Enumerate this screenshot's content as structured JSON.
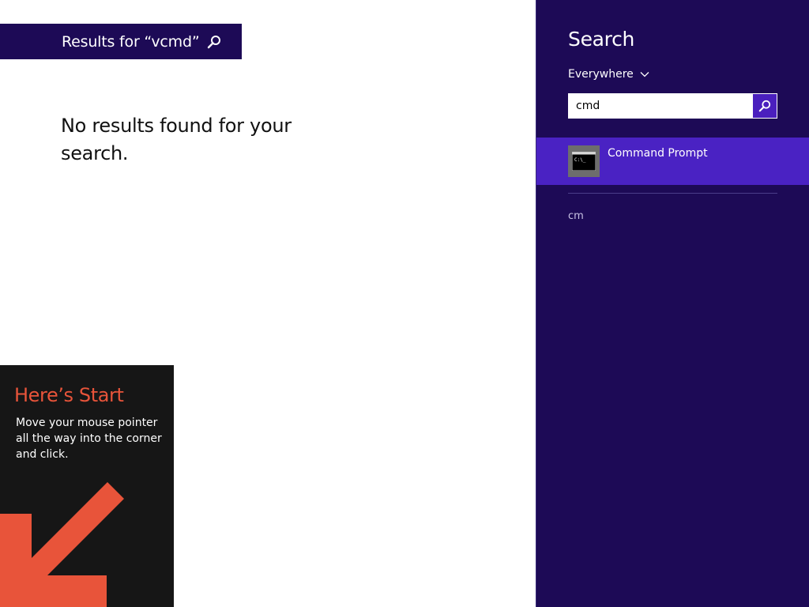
{
  "results_header": {
    "text": "Results for “vcmd”",
    "icon": "search-icon"
  },
  "main": {
    "message": "No results found for your search."
  },
  "start_tip": {
    "title": "Here’s Start",
    "body": "Move your mouse pointer all the way into the corner and click.",
    "arrow_icon": "arrow-down-left-icon"
  },
  "search_pane": {
    "title": "Search",
    "scope": {
      "label": "Everywhere",
      "icon": "chevron-down-icon"
    },
    "input": {
      "value": "cmd",
      "placeholder": ""
    },
    "go_icon": "search-icon",
    "results": [
      {
        "label": "Command Prompt",
        "icon": "command-prompt-icon"
      }
    ],
    "suggestions": [
      "cm"
    ]
  },
  "colors": {
    "pane_bg": "#1d0a56",
    "selected_bg": "#4a22c3",
    "accent": "#4a1fbe",
    "tip_title": "#e8543a",
    "tip_bg": "#161616"
  }
}
